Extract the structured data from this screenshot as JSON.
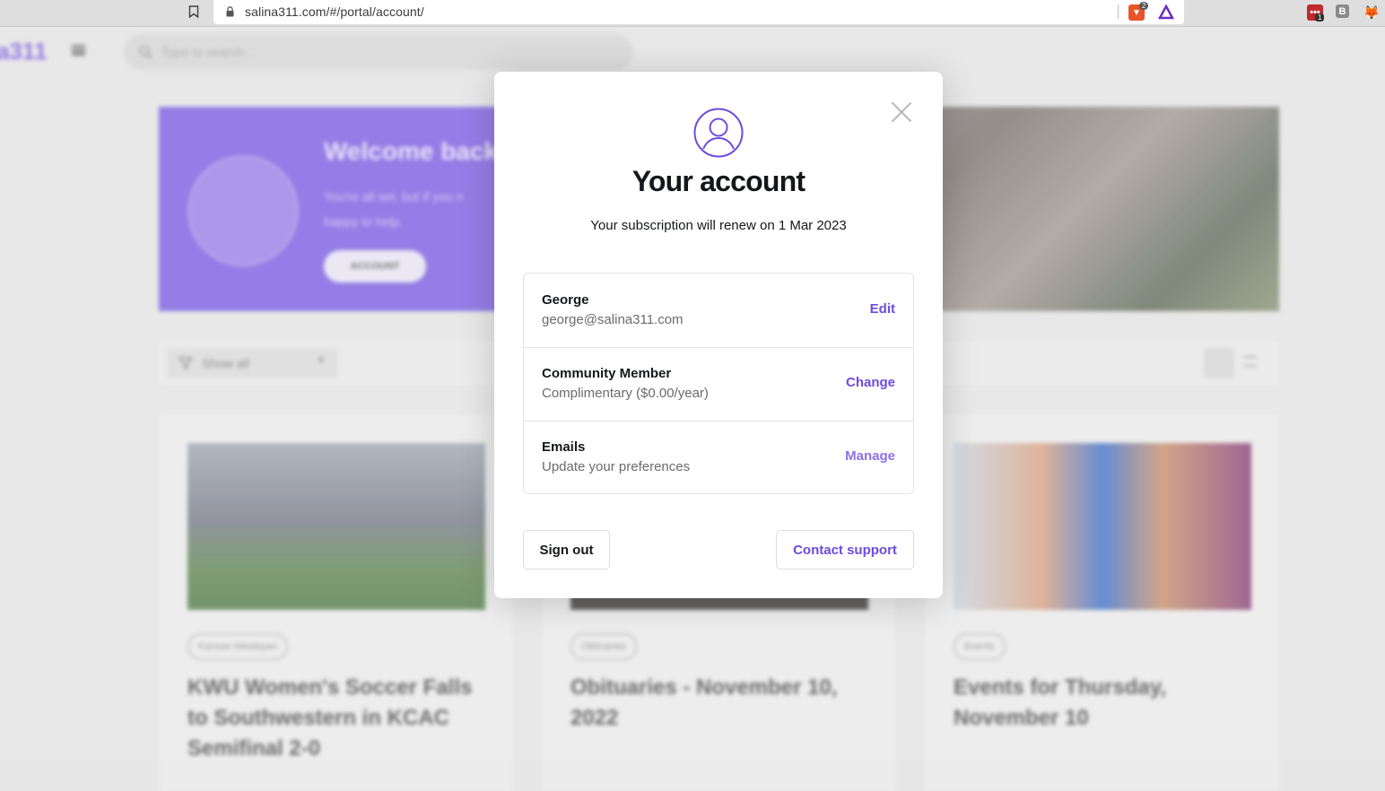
{
  "browser": {
    "url": "salina311.com/#/portal/account/",
    "extensions": [
      {
        "name": "brave-shield-icon",
        "badge": "2"
      },
      {
        "name": "brave-rewards-icon",
        "badge": ""
      },
      {
        "name": "lastpass-icon",
        "badge": "1"
      },
      {
        "name": "b-extension-icon",
        "badge": "B"
      },
      {
        "name": "metamask-icon",
        "badge": ""
      }
    ]
  },
  "background": {
    "logo": "a311",
    "search_placeholder": "Type to search...",
    "hero": {
      "title": "Welcome back",
      "subtitle_line1": "You're all set, but if you n",
      "subtitle_line2": "happy to help.",
      "button": "ACCOUNT"
    },
    "filter_label": "Show all",
    "cards": [
      {
        "tag": "Kansas Wesleyan",
        "title": "KWU Women's Soccer Falls to Southwestern in KCAC Semifinal 2-0"
      },
      {
        "tag": "Obituaries",
        "title": "Obituaries - November 10, 2022"
      },
      {
        "tag": "Events",
        "title": "Events for Thursday, November 10"
      }
    ]
  },
  "modal": {
    "title": "Your account",
    "subtitle": "Your subscription will renew on 1 Mar 2023",
    "rows": [
      {
        "title": "George",
        "subtitle": "george@salina311.com",
        "action": "Edit"
      },
      {
        "title": "Community Member",
        "subtitle": "Complimentary ($0.00/year)",
        "action": "Change"
      },
      {
        "title": "Emails",
        "subtitle": "Update your preferences",
        "action": "Manage"
      }
    ],
    "sign_out": "Sign out",
    "contact_support": "Contact support"
  },
  "colors": {
    "accent": "#6c4ce0",
    "hero_bg": "#6d4ce4"
  }
}
